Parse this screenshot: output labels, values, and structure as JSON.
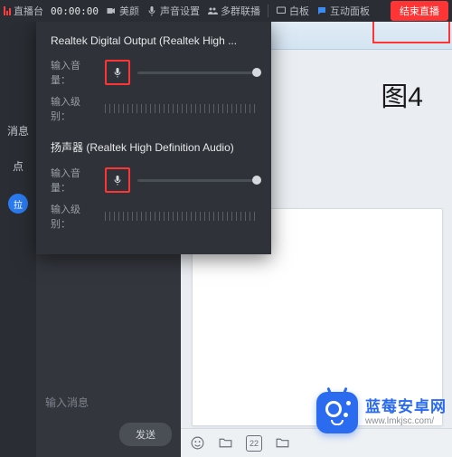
{
  "topbar": {
    "brand_label": "直播台",
    "timer": "00:00:00",
    "beauty_label": "美颜",
    "audio_label": "声音设置",
    "group_label": "多群联播",
    "whiteboard_label": "白板",
    "interact_label": "互动面板",
    "end_label": "结束直播"
  },
  "audio_panel": {
    "devices": [
      {
        "name": "Realtek Digital Output (Realtek High ...",
        "vol_label": "输入音量：",
        "lvl_label": "输入级别："
      },
      {
        "name": "扬声器 (Realtek High Definition Audio)",
        "vol_label": "输入音量：",
        "lvl_label": "输入级别："
      }
    ]
  },
  "left_rail": {
    "tab_message": "消息",
    "tab_dot": "点",
    "avatar_text": "拉"
  },
  "chat": {
    "input_placeholder": "输入消息",
    "send_label": "发送"
  },
  "content": {
    "figure_label": "图4"
  },
  "taskbar": {
    "date_text": "22"
  },
  "watermark": {
    "title": "蓝莓安卓网",
    "url": "www.lmkjsc.com/"
  }
}
